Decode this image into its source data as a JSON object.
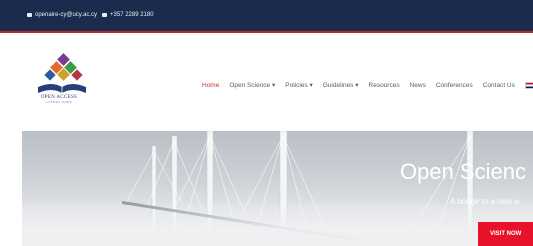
{
  "topbar": {
    "email": "openaire-cy@ucy.ac.cy",
    "phone": "+357 2289 2180",
    "email_icon": "envelope-icon",
    "phone_icon": "phone-icon"
  },
  "logo": {
    "line1": "OPEN ACCESS",
    "line2": "CYPRUS NODE"
  },
  "nav": {
    "items": [
      {
        "label": "Home",
        "active": true
      },
      {
        "label": "Open Science ▾"
      },
      {
        "label": "Policies ▾"
      },
      {
        "label": "Guidelines ▾"
      },
      {
        "label": "Resources"
      },
      {
        "label": "News"
      },
      {
        "label": "Conferences"
      },
      {
        "label": "Contact Us"
      }
    ],
    "language_icon": "uk-flag-icon"
  },
  "hero": {
    "title": "Open Scienc",
    "subtitle": "A bridge to a new w",
    "button_label": "VISIT NOW"
  },
  "colors": {
    "topbar": "#1a2b4c",
    "accent_red": "#d42e2e",
    "button_red": "#e8132b"
  }
}
